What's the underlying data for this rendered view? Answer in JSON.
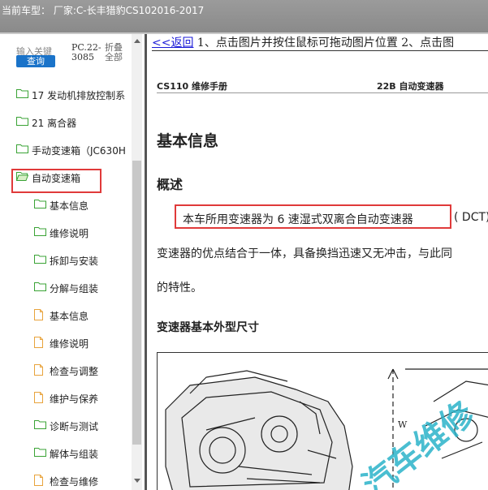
{
  "window": {
    "title": "当前车型：  厂家:C-长丰猎豹CS102016-2017"
  },
  "sidebar": {
    "search_placeholder": "输入关键",
    "search_button": "查询",
    "pc_code": "PC.22-3085",
    "fold_all": "折叠全部",
    "items": [
      {
        "label": "17 发动机排放控制系",
        "icon": "folder-icon",
        "level": 0
      },
      {
        "label": "21 离合器",
        "icon": "folder-icon",
        "level": 0
      },
      {
        "label": "手动变速箱（JC630H",
        "icon": "folder-icon",
        "level": 0
      },
      {
        "label": "自动变速箱",
        "icon": "folder-open-icon",
        "level": 0,
        "selected": true
      },
      {
        "label": "基本信息",
        "icon": "folder-icon",
        "level": 1
      },
      {
        "label": "维修说明",
        "icon": "folder-icon",
        "level": 1
      },
      {
        "label": "拆卸与安装",
        "icon": "folder-icon",
        "level": 1
      },
      {
        "label": "分解与组装",
        "icon": "folder-icon",
        "level": 1
      },
      {
        "label": "基本信息",
        "icon": "document-icon",
        "level": 1
      },
      {
        "label": "维修说明",
        "icon": "document-icon",
        "level": 1
      },
      {
        "label": "检查与调整",
        "icon": "document-icon",
        "level": 1
      },
      {
        "label": "维护与保养",
        "icon": "document-icon",
        "level": 1
      },
      {
        "label": "诊断与测试",
        "icon": "folder-icon",
        "level": 1
      },
      {
        "label": "解体与组装",
        "icon": "folder-icon",
        "level": 1
      },
      {
        "label": "检查与维修",
        "icon": "document-icon",
        "level": 1
      }
    ]
  },
  "content": {
    "back_link": "<<返回",
    "instructions": " 1、点击图片并按住鼠标可拖动图片位置 2、点击图",
    "doc_header_left": "CS110 维修手册",
    "doc_header_right": "22B 自动变速器",
    "heading_basic": "基本信息",
    "heading_overview": "概述",
    "para_line1": "本车所用变速器为 6 速湿式双离合自动变速器",
    "para_line1_tail": "( DCT),",
    "para_line2": "变速器的优点结合于一体，具备换挡迅速又无冲击，与此同",
    "para_line3": "的特性。",
    "heading_dims": "变速器基本外型尺寸",
    "figure_label": "W",
    "watermark": "汽车维修"
  },
  "colors": {
    "titlebar": "#8f8f8f",
    "highlight_border": "#e03a3a",
    "link": "#1a1ad8",
    "search_button": "#1a73c9",
    "folder_green": "#3aa335",
    "doc_orange": "#e8a33c"
  }
}
